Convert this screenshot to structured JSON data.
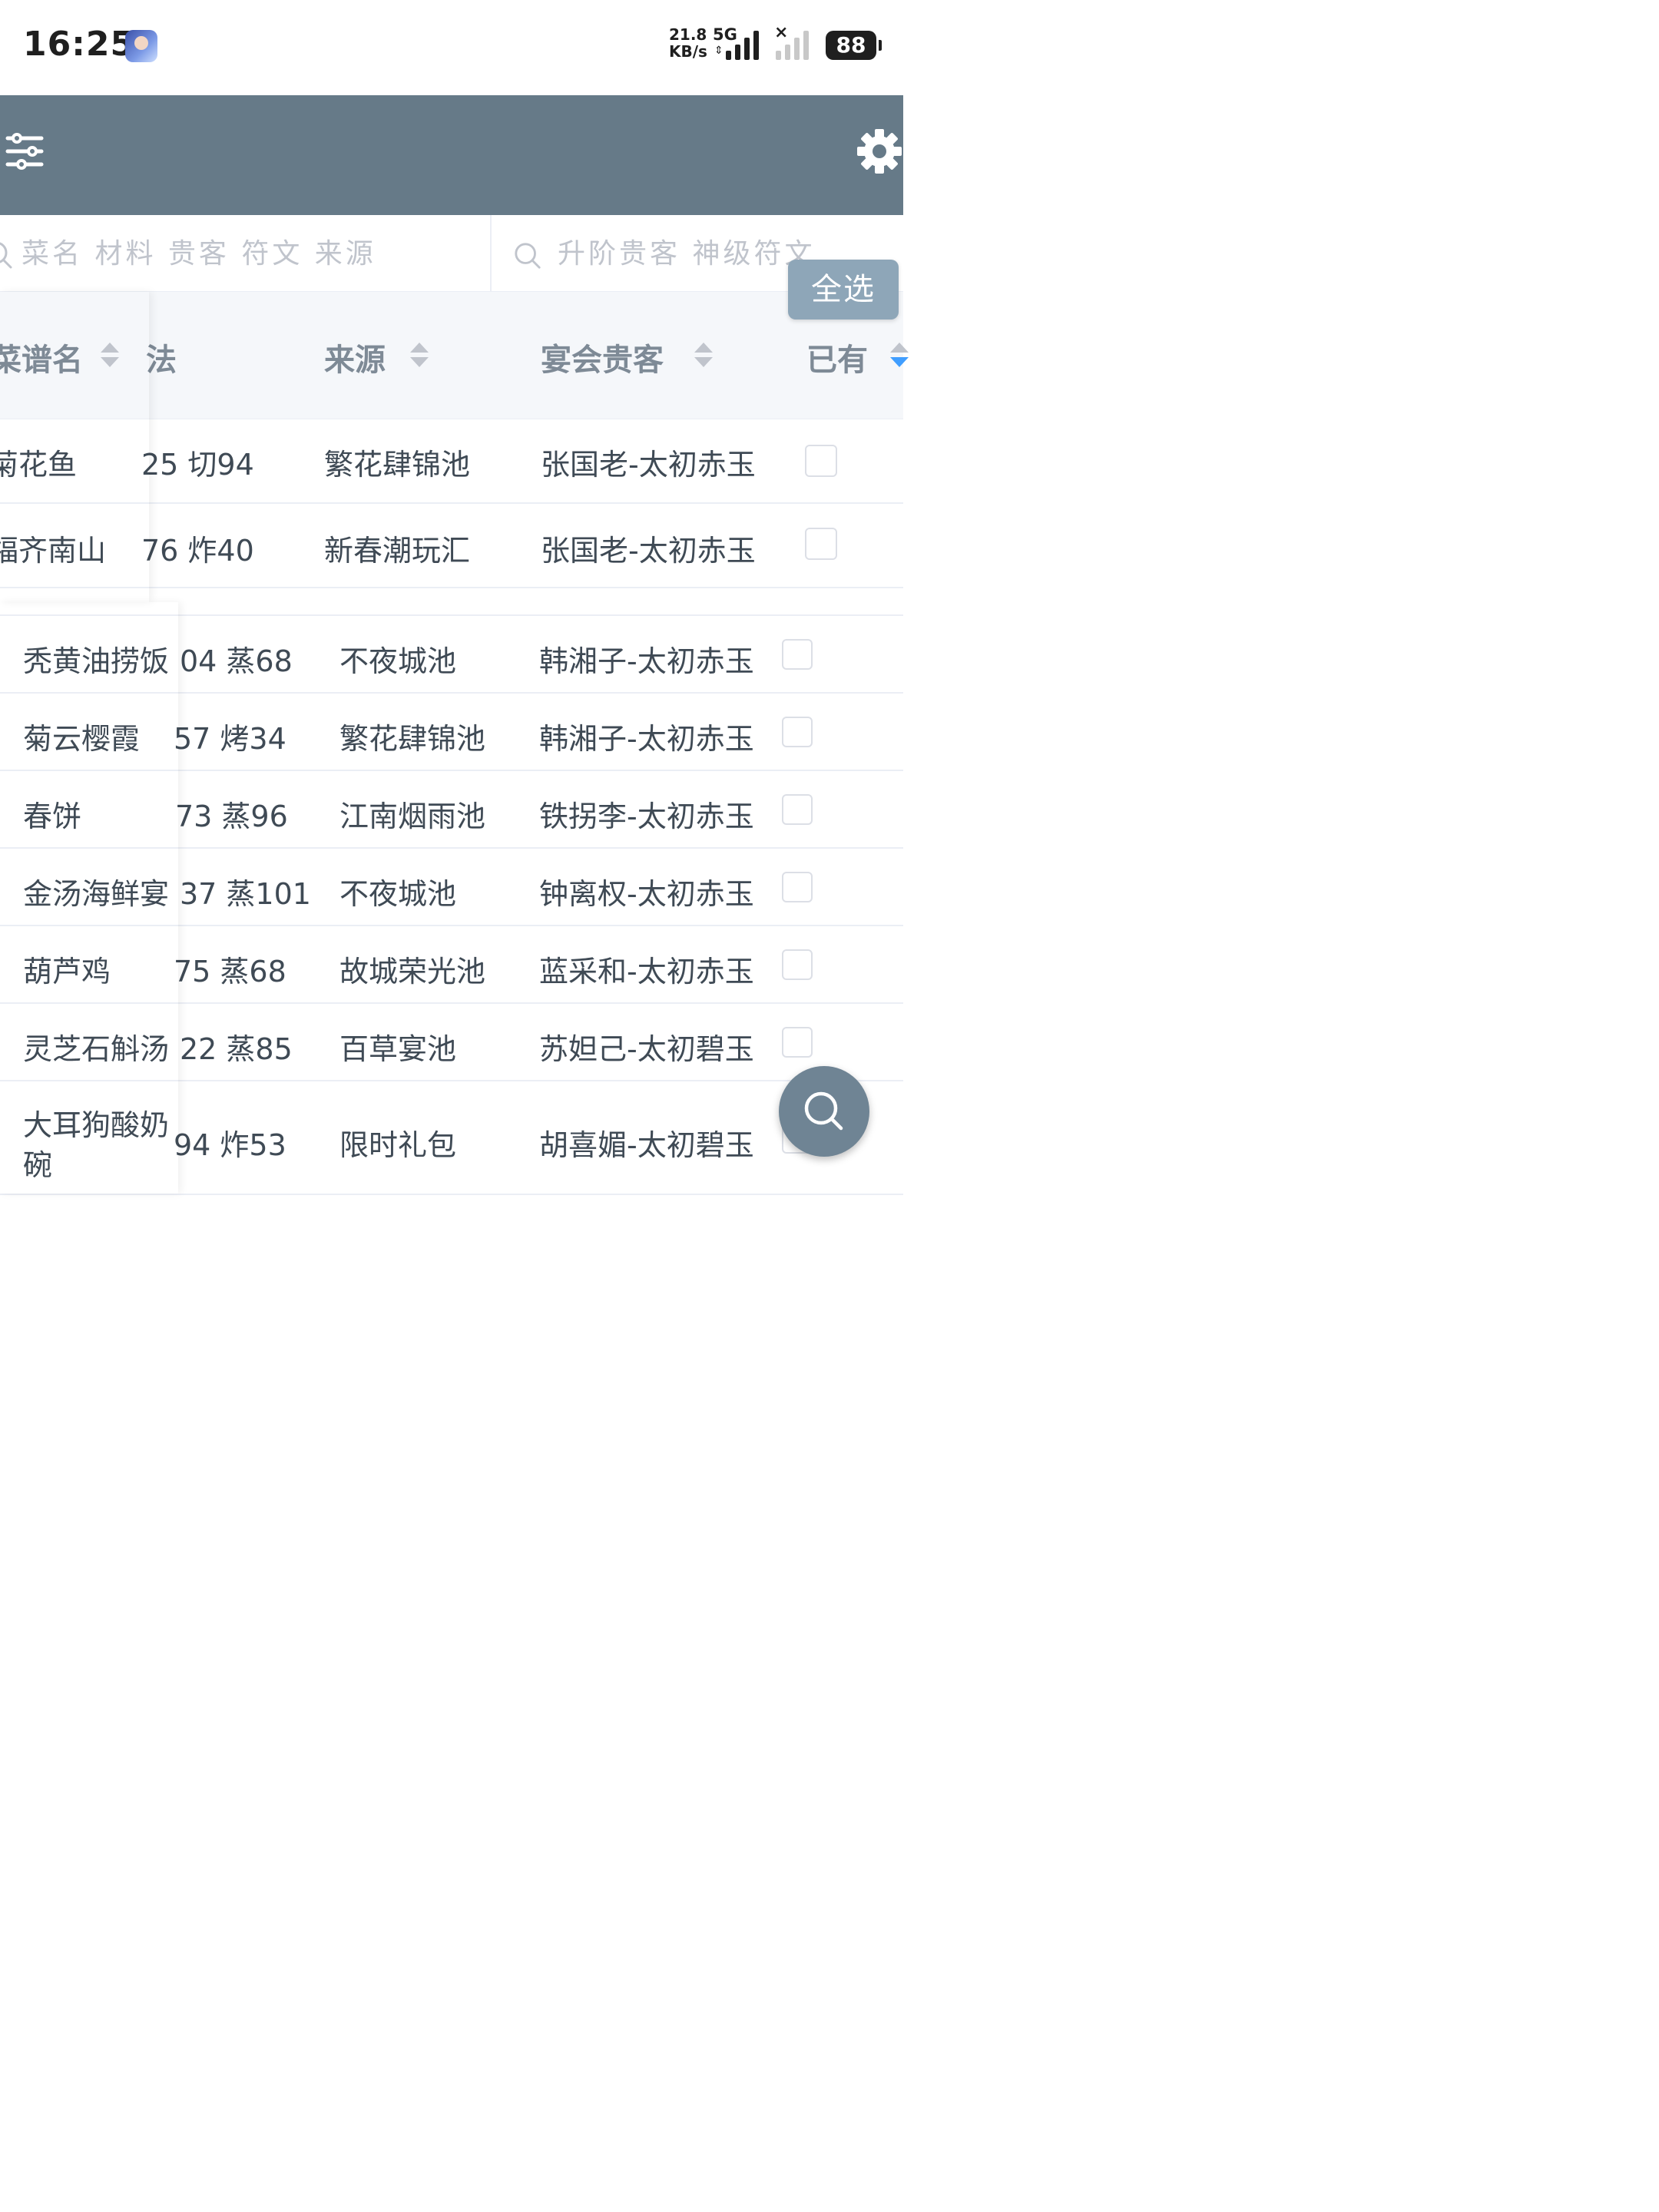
{
  "status_bar": {
    "time": "16:25",
    "net_speed_value": "21.8",
    "net_speed_unit": "KB/s",
    "network_type": "5G",
    "battery": "88"
  },
  "header": {
    "left_icon": "filter-sliders-icon",
    "right_icon": "gear-icon",
    "color": "#667a88"
  },
  "search": {
    "placeholder_1": "菜名 材料 贵客 符文 来源",
    "placeholder_2": "升阶贵客 神级符文",
    "select_all_label": "全选"
  },
  "table": {
    "columns": [
      "菜谱名",
      "法",
      "来源",
      "宴会贵客",
      "已有"
    ],
    "top_rows": [
      {
        "name": "菊花鱼",
        "method": "25 切94",
        "source": "繁花肆锦池",
        "guest": "张国老-太初赤玉"
      },
      {
        "name": "福齐南山",
        "method": "76 炸40",
        "source": "新春潮玩汇",
        "guest": "张国老-太初赤玉"
      }
    ],
    "bottom_rows": [
      {
        "name": "秃黄油捞饭",
        "method": "04 蒸68",
        "source": "不夜城池",
        "guest": "韩湘子-太初赤玉"
      },
      {
        "name": "菊云樱霞",
        "method": "57 烤34",
        "source": "繁花肆锦池",
        "guest": "韩湘子-太初赤玉"
      },
      {
        "name": "春饼",
        "method": "73 蒸96",
        "source": "江南烟雨池",
        "guest": "铁拐李-太初赤玉"
      },
      {
        "name": "金汤海鲜宴",
        "method": "37 蒸101",
        "source": "不夜城池",
        "guest": "钟离权-太初赤玉"
      },
      {
        "name": "葫芦鸡",
        "method": "75 蒸68",
        "source": "故城荣光池",
        "guest": "蓝采和-太初赤玉"
      },
      {
        "name": "灵芝石斛汤",
        "method": "22 蒸85",
        "source": "百草宴池",
        "guest": "苏妲己-太初碧玉"
      },
      {
        "name_line1": "大耳狗酸奶",
        "name_line2": "碗",
        "method": "94 炸53",
        "source": "限时礼包",
        "guest": "胡喜媚-太初碧玉"
      }
    ]
  },
  "fab": {
    "icon": "search-icon"
  }
}
